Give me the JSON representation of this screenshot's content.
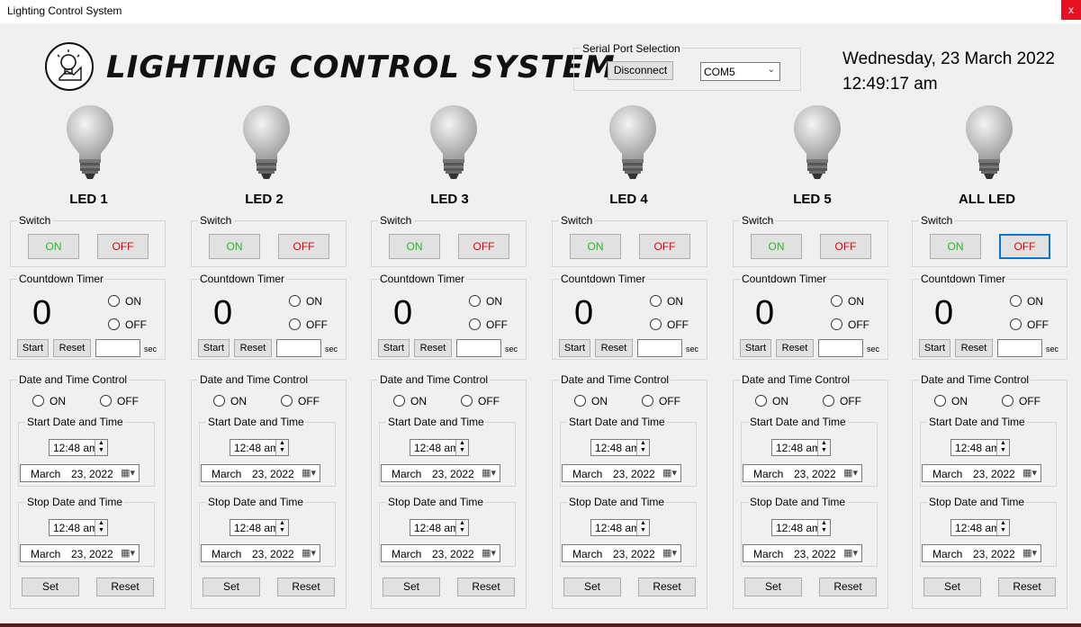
{
  "window": {
    "title": "Lighting Control System",
    "close_label": "x"
  },
  "header": {
    "title": "LIGHTING CONTROL SYSTEM"
  },
  "serial": {
    "legend": "Serial Port Selection",
    "disconnect_label": "Disconnect",
    "port": "COM5"
  },
  "datetime": {
    "date": "Wednesday, 23 March 2022",
    "time": "12:49:17 am"
  },
  "labels": {
    "switch": "Switch",
    "on": "ON",
    "off": "OFF",
    "countdown": "Countdown Timer",
    "start": "Start",
    "reset": "Reset",
    "sec": "sec",
    "dt_control": "Date and Time Control",
    "start_dt": "Start Date and Time",
    "stop_dt": "Stop Date and Time",
    "set": "Set"
  },
  "leds": [
    {
      "name": "LED 1",
      "count": "0",
      "start_time": "12:48 am",
      "start_month": "March",
      "start_day": "23, 2022",
      "stop_time": "12:48 am",
      "stop_month": "March",
      "stop_day": "23, 2022"
    },
    {
      "name": "LED 2",
      "count": "0",
      "start_time": "12:48 am",
      "start_month": "March",
      "start_day": "23, 2022",
      "stop_time": "12:48 am",
      "stop_month": "March",
      "stop_day": "23, 2022"
    },
    {
      "name": "LED 3",
      "count": "0",
      "start_time": "12:48 am",
      "start_month": "March",
      "start_day": "23, 2022",
      "stop_time": "12:48 am",
      "stop_month": "March",
      "stop_day": "23, 2022"
    },
    {
      "name": "LED 4",
      "count": "0",
      "start_time": "12:48 am",
      "start_month": "March",
      "start_day": "23, 2022",
      "stop_time": "12:48 am",
      "stop_month": "March",
      "stop_day": "23, 2022"
    },
    {
      "name": "LED 5",
      "count": "0",
      "start_time": "12:48 am",
      "start_month": "March",
      "start_day": "23, 2022",
      "stop_time": "12:48 am",
      "stop_month": "March",
      "stop_day": "23, 2022"
    },
    {
      "name": "ALL LED",
      "count": "0",
      "start_time": "12:48 am",
      "start_month": "March",
      "start_day": "23, 2022",
      "stop_time": "12:48 am",
      "stop_month": "March",
      "stop_day": "23, 2022"
    }
  ],
  "colors": {
    "on_text": "#22bb22",
    "off_text": "#e60000",
    "focus": "#0078d7"
  }
}
